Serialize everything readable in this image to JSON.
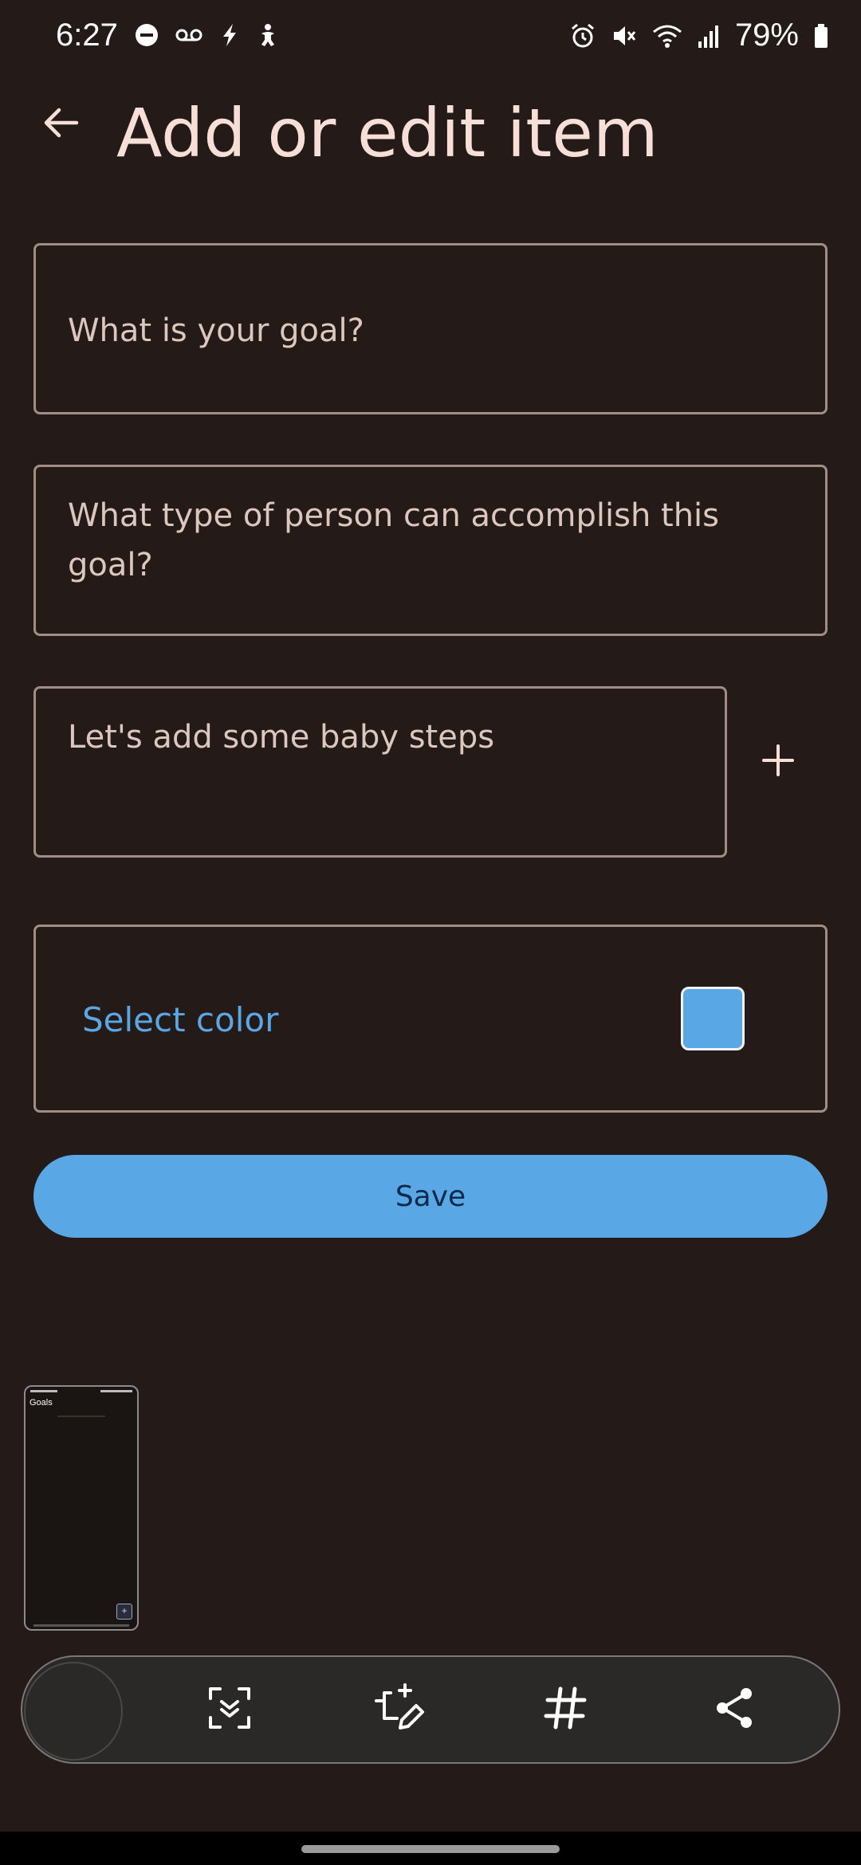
{
  "status_bar": {
    "time": "6:27",
    "battery": "79%",
    "left_icons": [
      "dnd-icon",
      "voicemail-icon",
      "charging-bolt-icon",
      "accessibility-icon"
    ],
    "right_icons": [
      "alarm-icon",
      "mute-icon",
      "wifi-icon",
      "signal-icon",
      "battery-icon"
    ]
  },
  "header": {
    "title": "Add or edit item"
  },
  "form": {
    "goal_placeholder": "What is your goal?",
    "person_placeholder": "What type of person can accomplish this goal?",
    "steps_placeholder": "Let's add some baby steps",
    "color_label": "Select color",
    "selected_color": "#5aa7e6",
    "save_label": "Save"
  },
  "thumbnail": {
    "title": "Goals"
  },
  "screenshot_toolbar": {
    "buttons": [
      "scan-text-icon",
      "crop-edit-icon",
      "hashtag-icon",
      "share-icon"
    ]
  },
  "colors": {
    "background": "#241a17",
    "accent": "#5aa7e6",
    "title": "#f7dfd7",
    "border": "#a08d86"
  }
}
